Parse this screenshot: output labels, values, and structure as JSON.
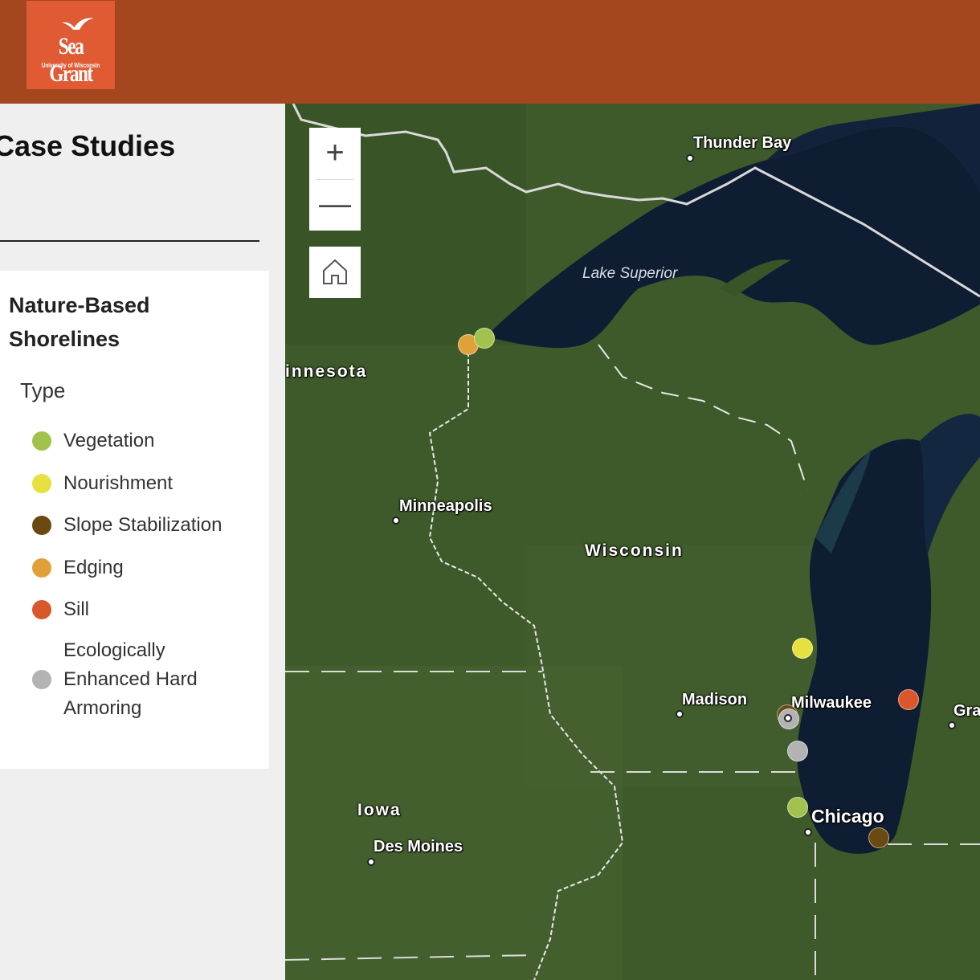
{
  "header": {
    "logo": {
      "name": "Sea Grant",
      "sub": "University of Wisconsin"
    }
  },
  "sidebar": {
    "title": "Case Studies"
  },
  "legend": {
    "layer_title": "Nature-Based Shorelines",
    "field": "Type",
    "items": [
      {
        "label": "Vegetation",
        "color": "#a2c14d"
      },
      {
        "label": "Nourishment",
        "color": "#e6e13e"
      },
      {
        "label": "Slope Stabilization",
        "color": "#6b4a12"
      },
      {
        "label": "Edging",
        "color": "#e0a03a"
      },
      {
        "label": "Sill",
        "color": "#d9572b"
      },
      {
        "label": "Ecologically Enhanced Hard Armoring",
        "color": "#b3b3b3"
      }
    ]
  },
  "map": {
    "controls": {
      "zoom_in": "+",
      "zoom_out": "—",
      "home_icon": "home-icon"
    },
    "labels": {
      "thunder_bay": "Thunder Bay",
      "lake_superior": "Lake Superior",
      "minnesota": "innesota",
      "minneapolis": "Minneapolis",
      "wisconsin": "Wisconsin",
      "madison": "Madison",
      "milwaukee": "Milwaukee",
      "grand_rapids": "Gra",
      "chicago": "Chicago",
      "iowa": "Iowa",
      "des_moines": "Des Moines"
    }
  }
}
